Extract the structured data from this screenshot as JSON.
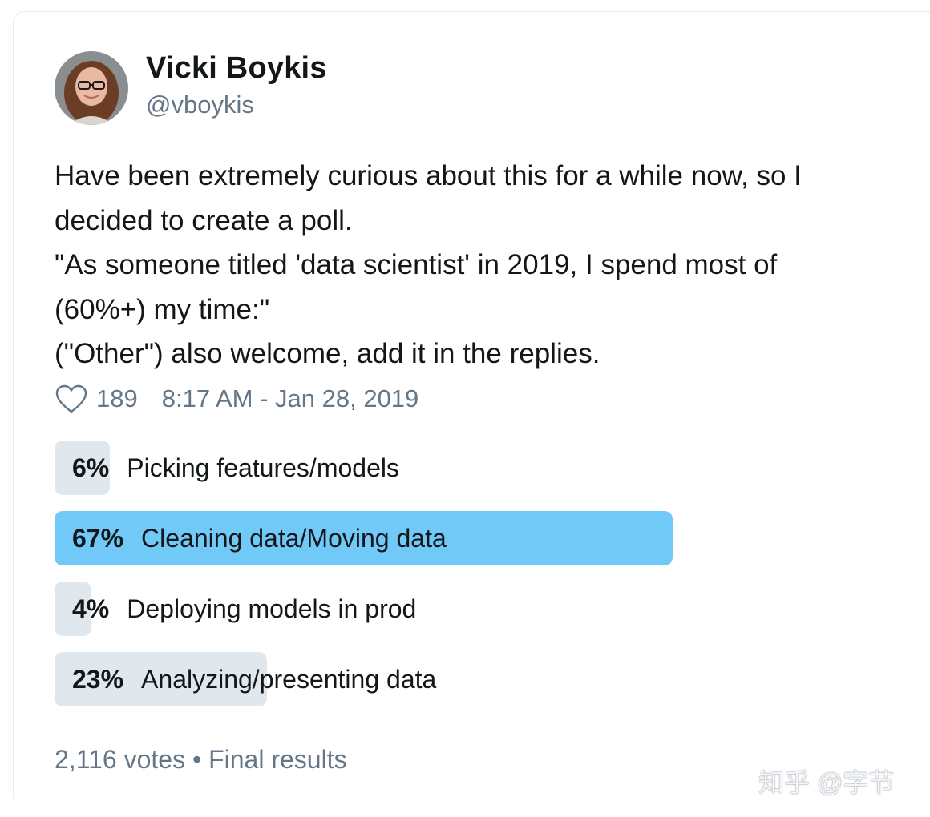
{
  "author": {
    "name": "Vicki Boykis",
    "handle": "@vboykis"
  },
  "tweet": {
    "lines": [
      "Have been extremely curious about this for a while now, so I",
      "decided to create a poll.",
      "\"As someone titled 'data scientist' in 2019, I spend most of",
      "(60%+)  my time:\"",
      "(\"Other\") also welcome, add it in the replies."
    ],
    "like_icon": "heart-outline-icon",
    "likes": "189",
    "timestamp": "8:17 AM - Jan 28, 2019"
  },
  "poll": {
    "options": [
      {
        "percent_label": "6%",
        "label": "Picking features/models",
        "percent": 6
      },
      {
        "percent_label": "67%",
        "label": "Cleaning data/Moving data",
        "percent": 67,
        "winner": true
      },
      {
        "percent_label": "4%",
        "label": "Deploying models in prod",
        "percent": 4
      },
      {
        "percent_label": "23%",
        "label": "Analyzing/presenting data",
        "percent": 23
      }
    ],
    "footer": "2,116 votes • Final results"
  },
  "colors": {
    "text": "#14171a",
    "secondary": "#657786",
    "bar": "#e1e8ed",
    "winner_bar": "#71c9f8"
  },
  "watermark": "知乎 @字节"
}
